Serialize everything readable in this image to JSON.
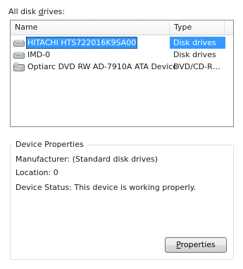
{
  "header": {
    "label_pre": "All disk ",
    "label_accel": "d",
    "label_post": "rives:"
  },
  "list": {
    "columns": [
      "Name",
      "Type"
    ],
    "rows": [
      {
        "name": "HITACHI HTS722016K9SA00",
        "type": "Disk drives",
        "icon": "hard-disk-icon",
        "selected": true
      },
      {
        "name": "IMD-0",
        "type": "Disk drives",
        "icon": "hard-disk-icon",
        "selected": false
      },
      {
        "name": "Optiarc DVD RW AD-7910A ATA Device",
        "type": "DVD/CD-R…",
        "icon": "dvd-drive-icon",
        "selected": false
      }
    ]
  },
  "device_properties": {
    "title": "Device Properties",
    "manufacturer": "Manufacturer: (Standard disk drives)",
    "location": "Location: 0",
    "status": "Device Status: This device is working properly."
  },
  "properties_button": {
    "accel": "P",
    "rest": "roperties"
  },
  "colors": {
    "selection": "#3399ff",
    "border": "#828790",
    "group_border": "#d5dfe5"
  }
}
